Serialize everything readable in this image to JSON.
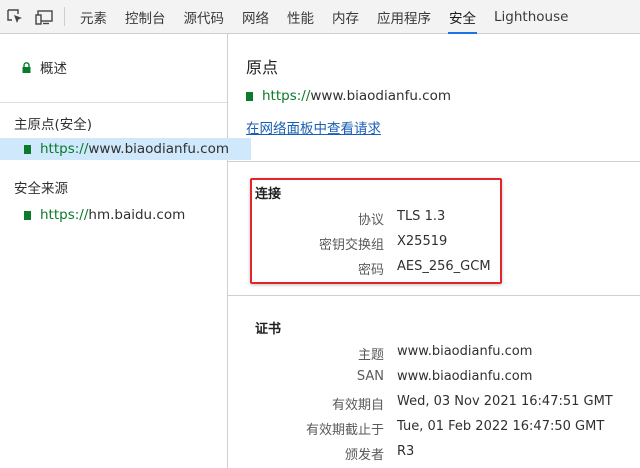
{
  "colors": {
    "accent": "#1a73e8",
    "secure_green": "#0a7a2b",
    "link": "#1a5fb4",
    "annotation_red": "#e0262b",
    "selected_bg": "#cfe8fc"
  },
  "toolbar": {
    "icons": [
      "inspect-element-icon",
      "device-toolbar-icon"
    ],
    "tabs": [
      "元素",
      "控制台",
      "源代码",
      "网络",
      "性能",
      "内存",
      "应用程序",
      "安全",
      "Lighthouse"
    ],
    "active_tab": "安全"
  },
  "sidebar": {
    "overview": "概述",
    "main_origin_heading": "主原点(安全)",
    "main_origin": {
      "scheme": "https://",
      "host": "www.biaodianfu.com"
    },
    "secure_sources_heading": "安全来源",
    "secure_source": {
      "scheme": "https://",
      "host": "hm.baidu.com"
    }
  },
  "main": {
    "title": "原点",
    "origin_url": {
      "scheme": "https://",
      "host": "www.biaodianfu.com"
    },
    "network_link": "在网络面板中查看请求",
    "connection": {
      "title": "连接",
      "rows": [
        {
          "label": "协议",
          "value": "TLS 1.3"
        },
        {
          "label": "密钥交换组",
          "value": "X25519"
        },
        {
          "label": "密码",
          "value": "AES_256_GCM"
        }
      ]
    },
    "certificate": {
      "title": "证书",
      "rows": [
        {
          "label": "主题",
          "value": "www.biaodianfu.com"
        },
        {
          "label": "SAN",
          "value": "www.biaodianfu.com"
        },
        {
          "label": "有效期自",
          "value": "Wed, 03 Nov 2021 16:47:51 GMT"
        },
        {
          "label": "有效期截止于",
          "value": "Tue, 01 Feb 2022 16:47:50 GMT"
        },
        {
          "label": "颁发者",
          "value": "R3"
        }
      ]
    }
  }
}
